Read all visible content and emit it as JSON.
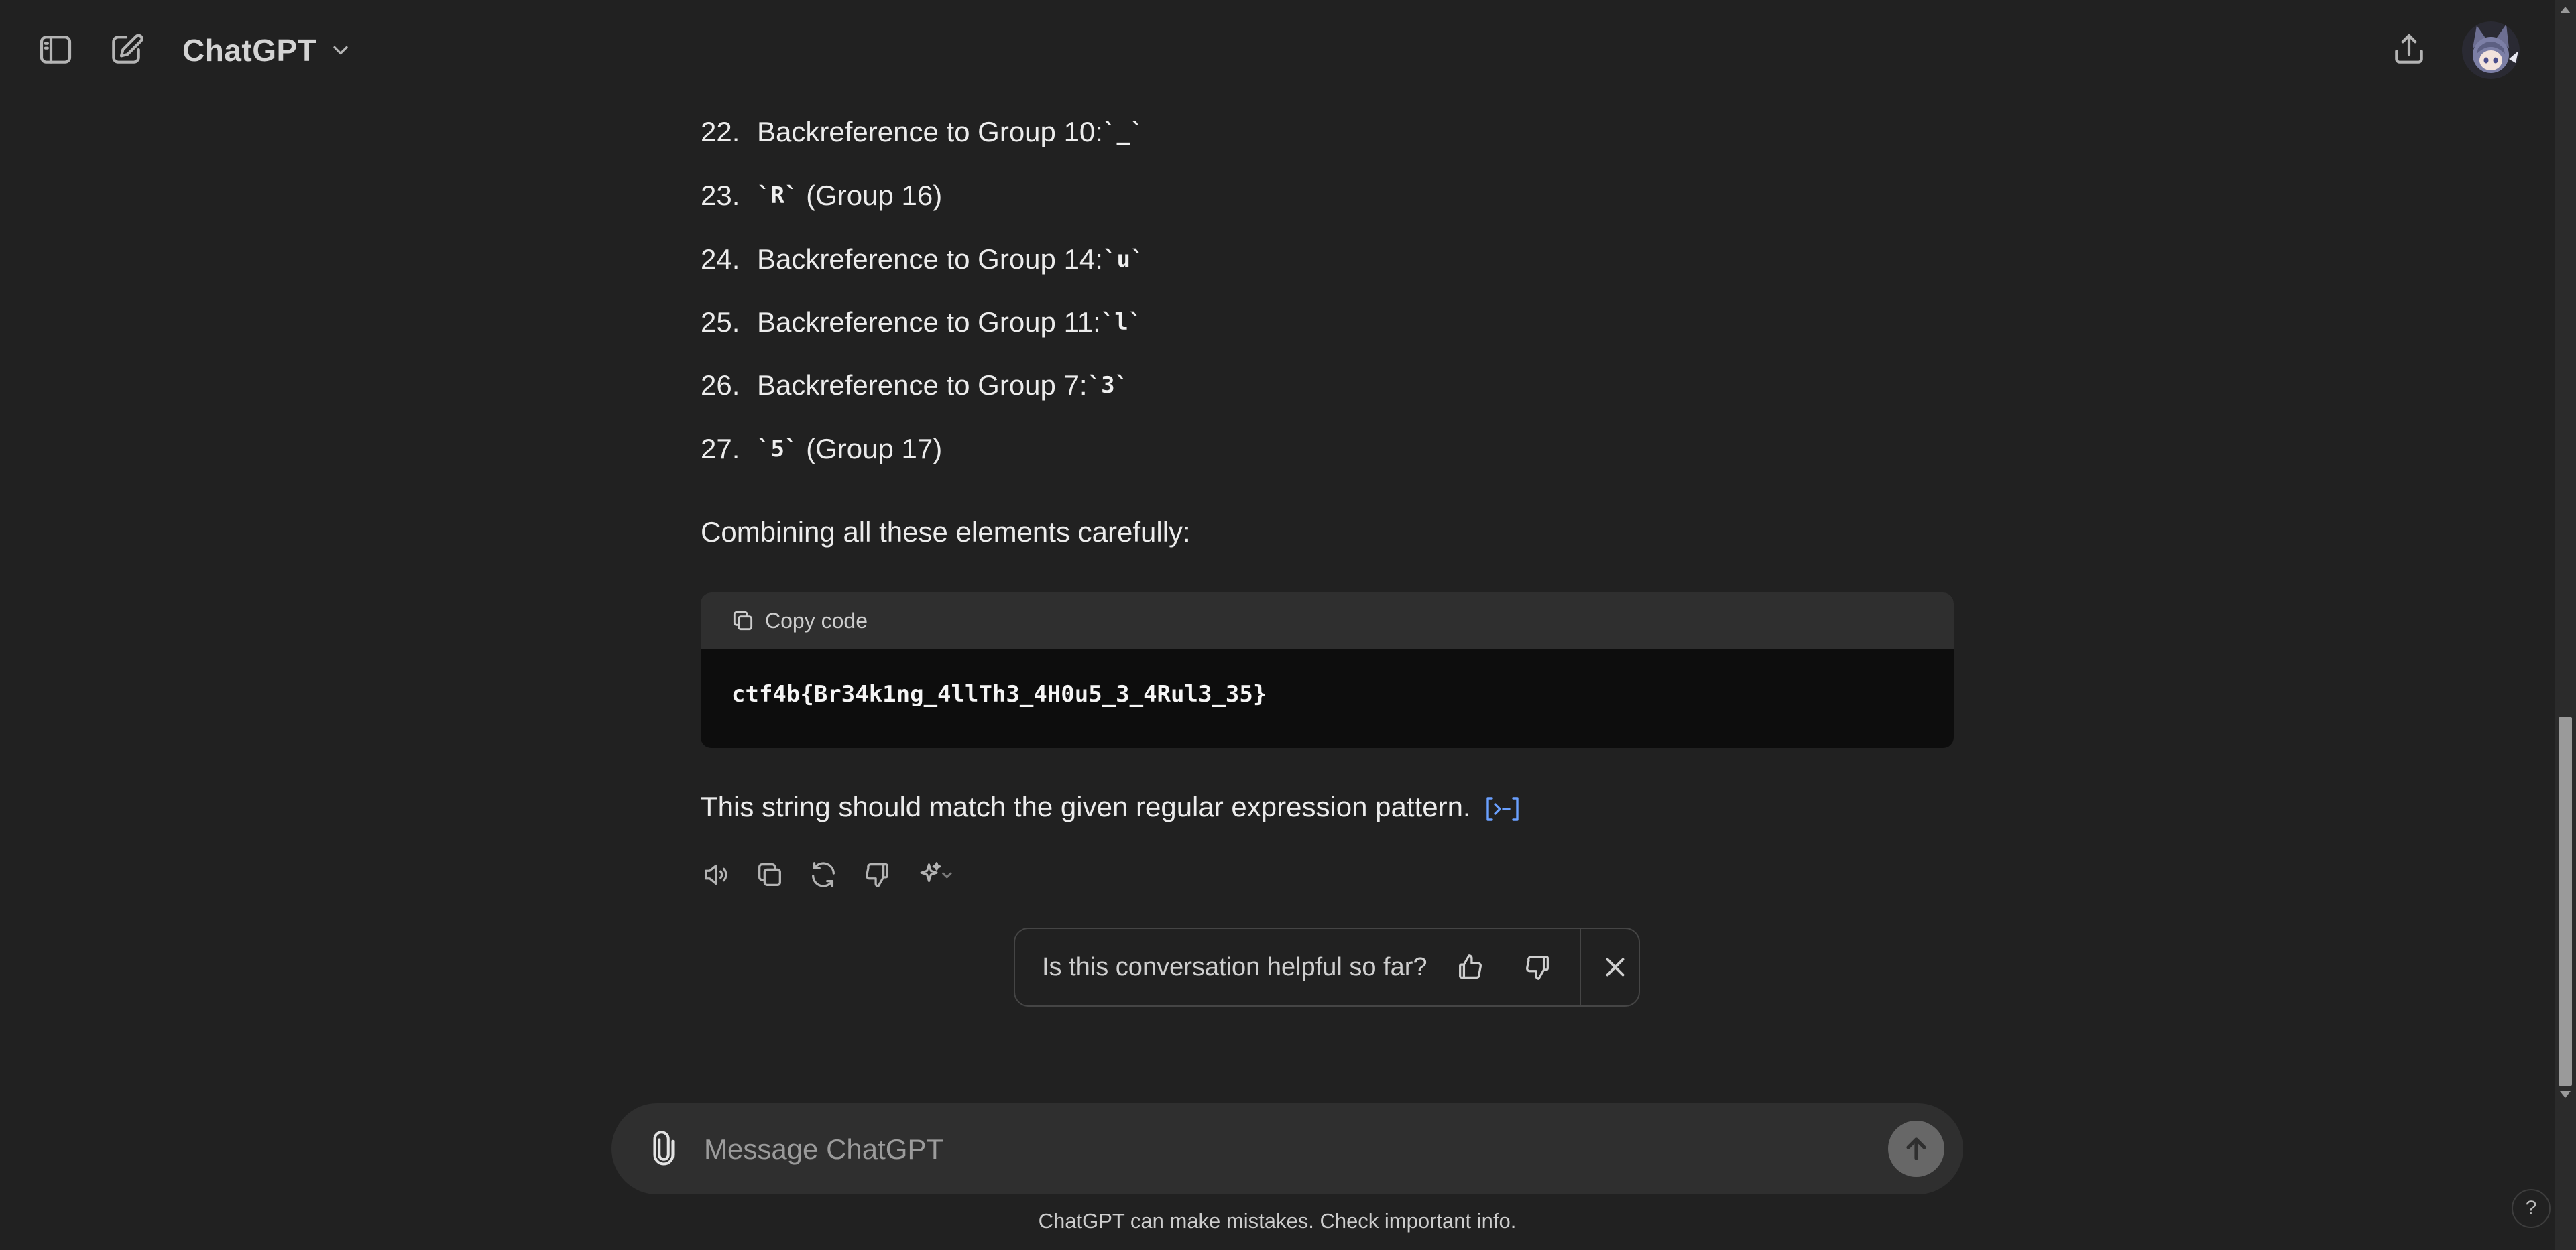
{
  "header": {
    "model_name": "ChatGPT"
  },
  "list_items": [
    {
      "num": "22.",
      "before": "Backreference to Group 10: ",
      "code": "`_`",
      "after": ""
    },
    {
      "num": "23.",
      "before": "",
      "code": "`R`",
      "after": " (Group 16)"
    },
    {
      "num": "24.",
      "before": "Backreference to Group 14: ",
      "code": "`u`",
      "after": ""
    },
    {
      "num": "25.",
      "before": "Backreference to Group 11: ",
      "code": "`l`",
      "after": ""
    },
    {
      "num": "26.",
      "before": "Backreference to Group 7: ",
      "code": "`3`",
      "after": ""
    },
    {
      "num": "27.",
      "before": "",
      "code": "`5`",
      "after": " (Group 17)"
    }
  ],
  "combining_text": "Combining all these elements carefully:",
  "code_block": {
    "copy_label": "Copy code",
    "code": "ctf4b{Br34k1ng_4llTh3_4H0u5_3_4Rul3_35}"
  },
  "conclusion_text": "This string should match the given regular expression pattern.",
  "feedback": {
    "question": "Is this conversation helpful so far?"
  },
  "composer": {
    "placeholder": "Message ChatGPT"
  },
  "disclaimer": "ChatGPT can make mistakes. Check important info.",
  "help": "?",
  "icons": {
    "sidebar_toggle": "sidebar-icon",
    "new_chat": "edit-icon",
    "share": "share-icon",
    "read_aloud": "speaker-icon",
    "copy": "copy-icon",
    "regenerate": "refresh-icon",
    "thumbs_down": "thumbs-down-icon",
    "model_switch": "sparkle-icon",
    "attach": "paperclip-icon",
    "send": "arrow-up-icon",
    "close": "close-icon",
    "citation": "citation-icon"
  },
  "colors": {
    "background": "#212121",
    "code_background": "#0d0d0d",
    "code_header": "#2f2f2f",
    "composer": "#2f2f2f",
    "citation": "#6aa0ff",
    "send_button": "#676767"
  }
}
